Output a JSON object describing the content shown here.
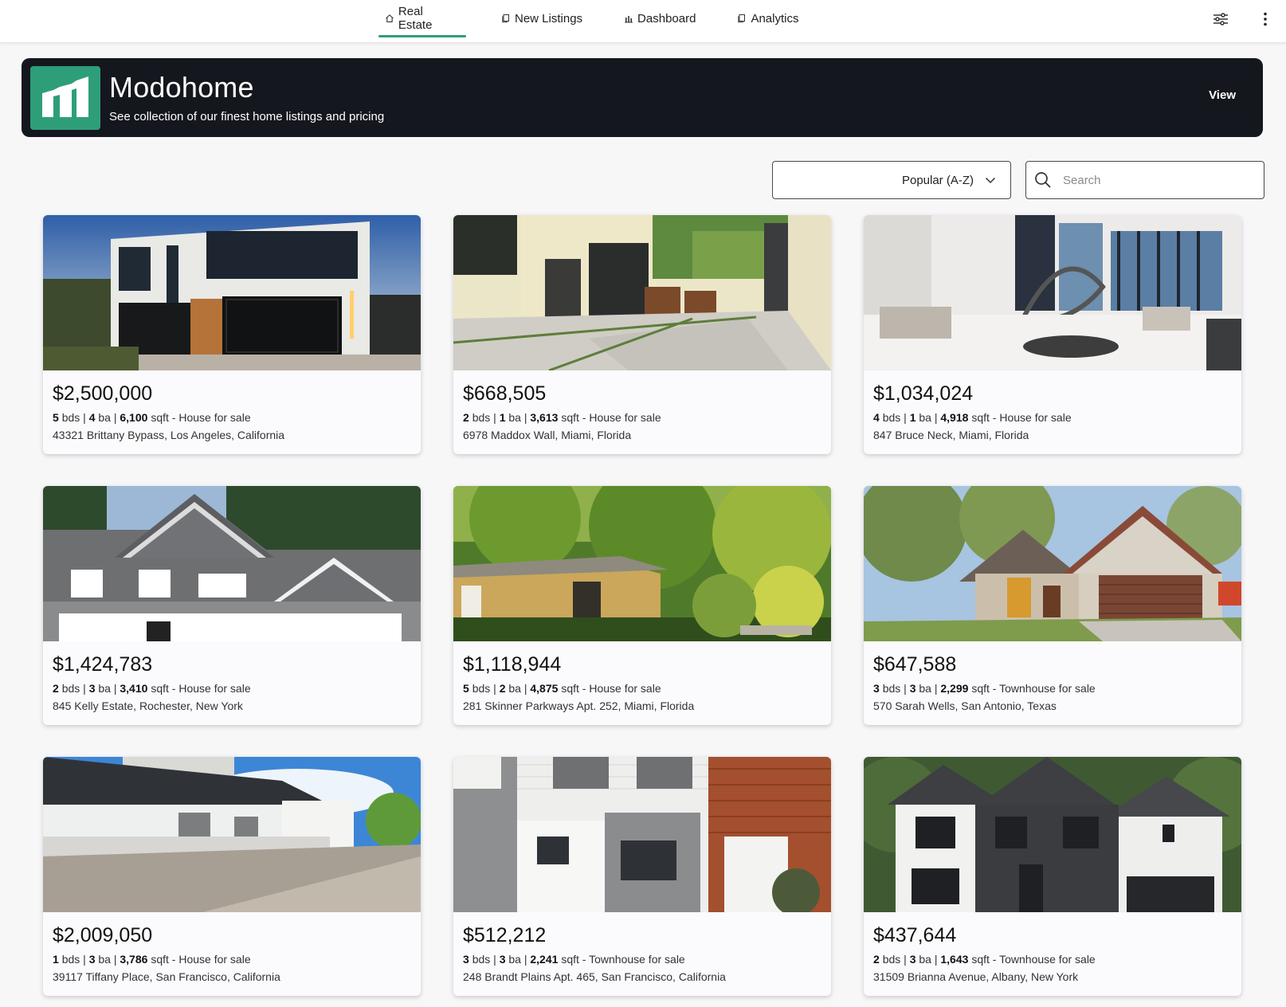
{
  "nav": {
    "tabs": [
      {
        "label": "Real Estate",
        "icon": "home-icon",
        "active": true
      },
      {
        "label": "New Listings",
        "icon": "copy-icon",
        "active": false
      },
      {
        "label": "Dashboard",
        "icon": "bar-chart-icon",
        "active": false
      },
      {
        "label": "Analytics",
        "icon": "copy-icon",
        "active": false
      }
    ],
    "actions": [
      "tune-icon",
      "more-vert-icon"
    ]
  },
  "banner": {
    "brand": "Modohome",
    "subtitle": "See collection of our finest home listings and pricing",
    "view_label": "View",
    "logo_color": "#2e9e79"
  },
  "controls": {
    "sort_value": "Popular (A-Z)",
    "search_placeholder": "Search",
    "search_value": ""
  },
  "listings": [
    {
      "price": "$2,500,000",
      "beds": "5",
      "baths": "4",
      "sqft": "6,100",
      "type": "House for sale",
      "address": "43321 Brittany Bypass, Los Angeles, California",
      "photo_scene": "modern-white-house-dusk"
    },
    {
      "price": "$668,505",
      "beds": "2",
      "baths": "1",
      "sqft": "3,613",
      "type": "House for sale",
      "address": "6978 Maddox Wall, Miami, Florida",
      "photo_scene": "patio-courtyard"
    },
    {
      "price": "$1,034,024",
      "beds": "4",
      "baths": "1",
      "sqft": "4,918",
      "type": "House for sale",
      "address": "847 Bruce Neck, Miami, Florida",
      "photo_scene": "interior-spiral-stair"
    },
    {
      "price": "$1,424,783",
      "beds": "2",
      "baths": "3",
      "sqft": "3,410",
      "type": "House for sale",
      "address": "845 Kelly Estate, Rochester, New York",
      "photo_scene": "gray-two-story-house"
    },
    {
      "price": "$1,118,944",
      "beds": "5",
      "baths": "2",
      "sqft": "4,875",
      "type": "House for sale",
      "address": "281 Skinner Parkways Apt. 252, Miami, Florida",
      "photo_scene": "tropical-garden-house"
    },
    {
      "price": "$647,588",
      "beds": "3",
      "baths": "3",
      "sqft": "2,299",
      "type": "Townhouse for sale",
      "address": "570 Sarah Wells, San Antonio, Texas",
      "photo_scene": "brick-house-garage"
    },
    {
      "price": "$2,009,050",
      "beds": "1",
      "baths": "3",
      "sqft": "3,786",
      "type": "House for sale",
      "address": "39117 Tiffany Place, San Francisco, California",
      "photo_scene": "white-house-carport"
    },
    {
      "price": "$512,212",
      "beds": "3",
      "baths": "3",
      "sqft": "2,241",
      "type": "Townhouse for sale",
      "address": "248 Brandt Plains Apt. 465, San Francisco, California",
      "photo_scene": "gray-white-townhouse"
    },
    {
      "price": "$437,644",
      "beds": "2",
      "baths": "3",
      "sqft": "1,643",
      "type": "Townhouse for sale",
      "address": "31509 Brianna Avenue, Albany, New York",
      "photo_scene": "dark-modern-farmhouse"
    }
  ],
  "labels": {
    "beds_unit": "bds",
    "baths_unit": "ba",
    "sqft_unit": "sqft",
    "separator": "|"
  },
  "colors": {
    "accent": "#2e9e79",
    "banner_bg": "#15171e",
    "page_bg": "#f7f7f8"
  }
}
